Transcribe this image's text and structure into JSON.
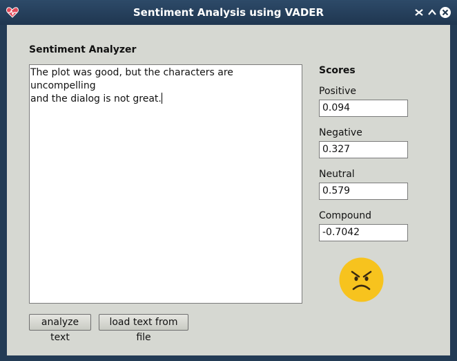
{
  "window": {
    "title": "Sentiment Analysis using VADER"
  },
  "analyzer": {
    "heading": "Sentiment Analyzer",
    "text": "The plot was good, but the characters are uncompelling\nand the dialog is not great."
  },
  "buttons": {
    "analyze_label": "analyze text",
    "load_label": "load text from file"
  },
  "scores": {
    "heading": "Scores",
    "positive_label": "Positive",
    "positive_value": "0.094",
    "negative_label": "Negative",
    "negative_value": "0.327",
    "neutral_label": "Neutral",
    "neutral_value": "0.579",
    "compound_label": "Compound",
    "compound_value": "-0.7042"
  },
  "indicator": {
    "icon": "angry-face-icon",
    "color": "#f7c31e"
  }
}
